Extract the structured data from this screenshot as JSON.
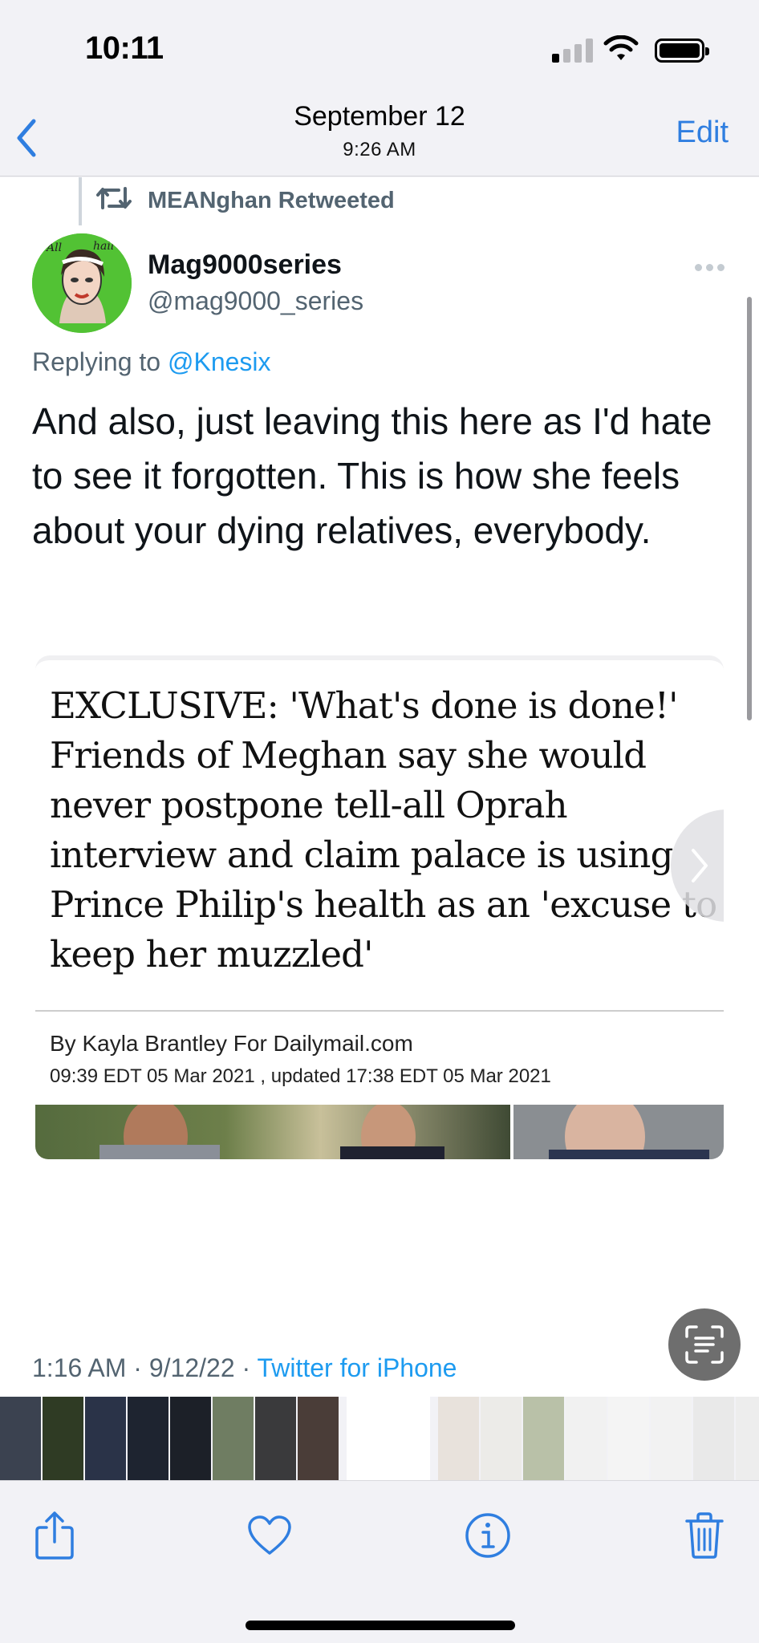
{
  "status_bar": {
    "time": "10:11"
  },
  "nav": {
    "date": "September 12",
    "time": "9:26 AM",
    "edit_label": "Edit"
  },
  "tweet": {
    "retweeted_by": "MEANghan Retweeted",
    "display_name": "Mag9000series",
    "handle": "@mag9000_series",
    "replying_prefix": "Replying to ",
    "replying_mention": "@Knesix",
    "text": "And also, just leaving this here as I'd hate to see it forgotten. This is how she feels about your dying relatives, everybody.",
    "timestamp": "1:16 AM · 9/12/22 · ",
    "source": "Twitter for iPhone"
  },
  "article": {
    "headline": "EXCLUSIVE: 'What's done is done!' Friends of Meghan say she would never postpone tell-all Oprah interview and claim palace is using Prince Philip's health as an 'excuse to keep her muzzled'",
    "byline": "By Kayla Brantley For Dailymail.com",
    "dateline": "09:39 EDT 05 Mar 2021 , updated 17:38 EDT 05 Mar 2021"
  },
  "thumbnails": [
    {
      "color": "#3b4250"
    },
    {
      "color": "#2f3b24"
    },
    {
      "color": "#2a3348"
    },
    {
      "color": "#1e2430"
    },
    {
      "color": "#1c2028"
    },
    {
      "color": "#6f7d62"
    },
    {
      "color": "#3a3a3c"
    },
    {
      "color": "#4a3d38"
    },
    {
      "color": "#ffffff",
      "selected": true
    },
    {
      "color": "#e8e2dc"
    },
    {
      "color": "#ecebe8"
    },
    {
      "color": "#b9c1a8"
    },
    {
      "color": "#f1f1f1"
    },
    {
      "color": "#f4f4f4"
    },
    {
      "color": "#f2f2f2"
    },
    {
      "color": "#e9e9e9"
    },
    {
      "color": "#ededed"
    }
  ],
  "toolbar": {
    "share_icon": "share-icon",
    "like_icon": "heart-icon",
    "info_icon": "info-icon",
    "delete_icon": "trash-icon"
  },
  "colors": {
    "accent": "#2f7ee0",
    "twitter_blue": "#1d9bf0",
    "muted": "#536471"
  }
}
